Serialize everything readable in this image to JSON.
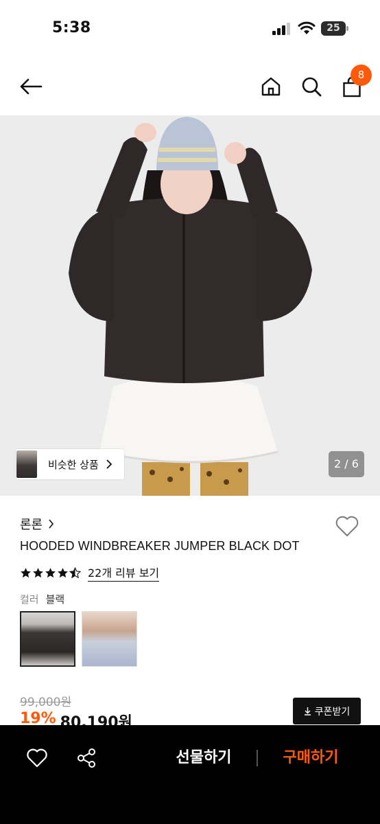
{
  "status_bar": {
    "time": "5:38",
    "battery_level": "25",
    "icons": [
      "signal-icon",
      "wifi-icon",
      "battery-icon"
    ]
  },
  "header": {
    "icons": [
      "back-arrow-icon",
      "home-icon",
      "search-icon",
      "shopping-bag-icon"
    ],
    "cart_count": "8",
    "badge_color": "#ff5a0a"
  },
  "gallery": {
    "similar_label": "비슷한 상품",
    "page_indicator": "2 / 6"
  },
  "product": {
    "brand": "론론",
    "name": "HOODED WINDBREAKER JUMPER BLACK DOT",
    "rating": 4.5,
    "review_link": "22개 리뷰 보기",
    "option_label": "컬러",
    "option_value": "블랙",
    "original_price": "99,000원",
    "discount": "19%",
    "sale_price": "80,190원",
    "coupon_label": "쿠폰받기"
  },
  "bottom_bar": {
    "gift_label": "선물하기",
    "buy_label": "구매하기",
    "accent_color": "#ff5a0a",
    "icons": [
      "heart-icon",
      "share-icon"
    ]
  }
}
